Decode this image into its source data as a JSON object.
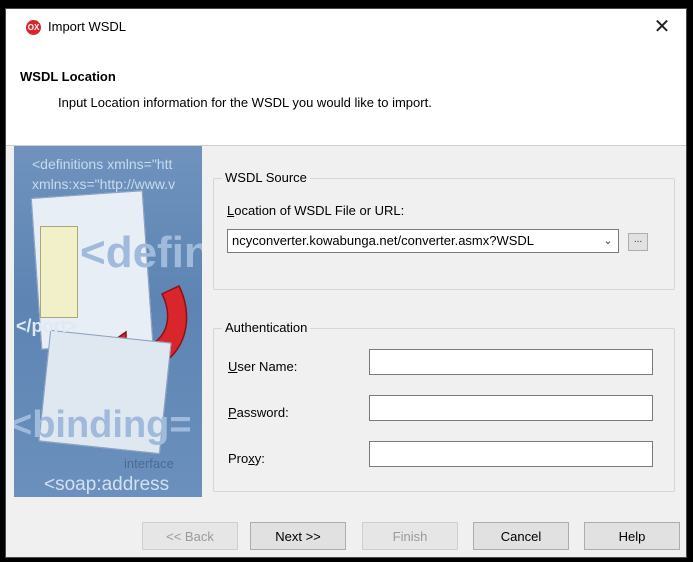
{
  "window": {
    "title": "Import WSDL",
    "app_icon_text": "OX",
    "close_symbol": "✕"
  },
  "header": {
    "title": "WSDL Location",
    "subtitle": "Input Location information for the WSDL you would like to import."
  },
  "side_image": {
    "line1": "<definitions xmlns=\"htt",
    "line2": "xmlns:xs=\"http://www.v",
    "big1": "<defini",
    "port": "</port>",
    "big2": "<binding=",
    "interface": "interface",
    "soap": "<soap:address"
  },
  "wsdl_source": {
    "group_label": "WSDL Source",
    "location_label_prefix": "L",
    "location_label_rest": "ocation of WSDL File or URL:",
    "location_value": "ncyconverter.kowabunga.net/converter.asmx?WSDL",
    "dropdown_icon": "chevron-down-icon",
    "browse_label": "..."
  },
  "authentication": {
    "group_label": "Authentication",
    "user_prefix": "U",
    "user_rest": "ser Name:",
    "user_value": "",
    "password_prefix": "P",
    "password_rest": "assword:",
    "password_value": "",
    "proxy_pre": "Pro",
    "proxy_u": "x",
    "proxy_rest": "y:",
    "proxy_value": ""
  },
  "buttons": {
    "back": "<< Back",
    "next": "Next >>",
    "finish": "Finish",
    "cancel": "Cancel",
    "help": "Help"
  }
}
